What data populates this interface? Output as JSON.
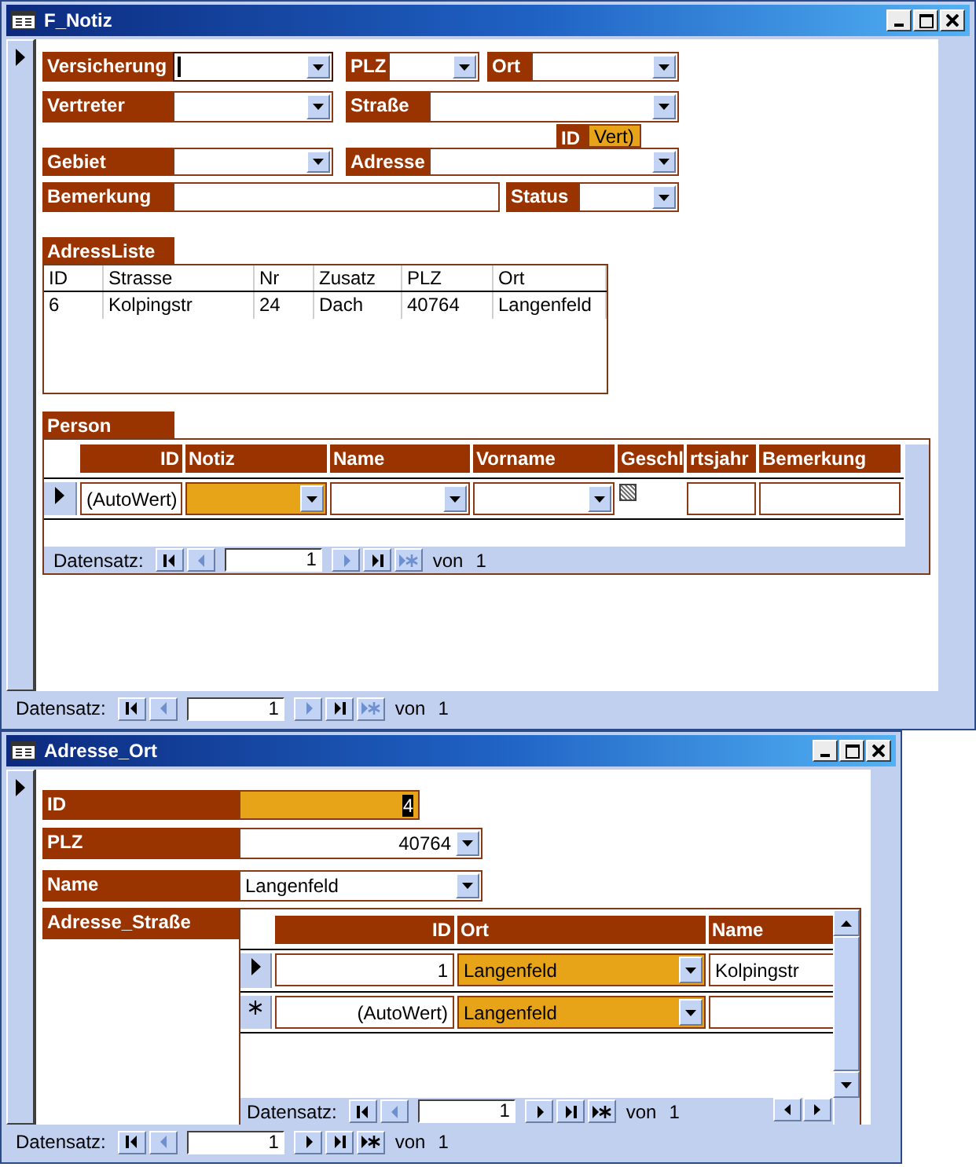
{
  "notiz_window": {
    "title": "F_Notiz",
    "record_selector": {
      "kind": "current"
    },
    "field_rows": [
      [
        {
          "label": "Versicherung",
          "kind": "combo",
          "focused": true
        },
        {
          "label": "PLZ",
          "kind": "combo",
          "focused": false
        },
        {
          "label": "Ort",
          "kind": "combo",
          "focused": false
        }
      ],
      [
        {
          "label": "Vertreter",
          "kind": "combo",
          "focused": false
        },
        {
          "label": "Straße",
          "kind": "combo",
          "focused": false
        }
      ],
      [
        {
          "label": "Gebiet",
          "kind": "combo",
          "focused": false
        },
        {
          "label": "Adresse",
          "kind": "combo",
          "focused": false
        }
      ],
      [
        {
          "label": "Bemerkung",
          "kind": "text",
          "focused": false
        },
        {
          "label": "Status",
          "kind": "combo",
          "focused": false
        }
      ]
    ],
    "id_vert": {
      "label": "ID",
      "value": "Vert)",
      "highlighted": true
    },
    "adress_liste": {
      "title": "AdressListe",
      "columns": [
        "ID",
        "Strasse",
        "Nr",
        "Zusatz",
        "PLZ",
        "Ort"
      ],
      "rows": [
        [
          "6",
          "Kolpingstr",
          "24",
          "Dach",
          "40764",
          "Langenfeld"
        ]
      ]
    },
    "person": {
      "title": "Person",
      "columns": [
        {
          "label": "ID",
          "kind": "number"
        },
        {
          "label": "Notiz",
          "kind": "combo"
        },
        {
          "label": "Name",
          "kind": "combo"
        },
        {
          "label": "Vorname",
          "kind": "combo"
        },
        {
          "label": "Geschl",
          "kind": "checkbox"
        },
        {
          "label": "rtsjahr",
          "kind": "text"
        },
        {
          "label": "Bemerkung",
          "kind": "text"
        }
      ],
      "rows": [
        {
          "kind": "current",
          "cells": [
            {
              "value": "(AutoWert)",
              "highlighted": false
            },
            {
              "highlighted": true
            },
            {
              "highlighted": false
            },
            {
              "highlighted": false
            },
            {
              "indeterminate": true
            },
            {
              "highlighted": false
            },
            {
              "highlighted": false
            }
          ]
        }
      ],
      "navigator": {
        "label": "Datensatz:",
        "value": "1",
        "buttons": [
          {
            "kind": "first",
            "disabled": false
          },
          {
            "kind": "previous",
            "disabled": true
          },
          {
            "kind": "next",
            "disabled": true
          },
          {
            "kind": "last",
            "disabled": false
          },
          {
            "kind": "new",
            "disabled": true
          }
        ],
        "of_label": "von",
        "total": "1"
      }
    },
    "navigator": {
      "label": "Datensatz:",
      "value": "1",
      "buttons": [
        {
          "kind": "first",
          "disabled": false
        },
        {
          "kind": "previous",
          "disabled": true
        },
        {
          "kind": "next",
          "disabled": true
        },
        {
          "kind": "last",
          "disabled": false
        },
        {
          "kind": "new",
          "disabled": true
        }
      ],
      "of_label": "von",
      "total": "1"
    }
  },
  "adresse_window": {
    "title": "Adresse_Ort",
    "record_selector": {
      "kind": "current"
    },
    "fields": [
      {
        "label": "ID",
        "kind": "number",
        "value": "4",
        "highlighted": true,
        "text_selected": true
      },
      {
        "label": "PLZ",
        "kind": "number_combo",
        "value": "40764",
        "highlighted": false,
        "text_selected": false
      },
      {
        "label": "Name",
        "kind": "combo",
        "value": "Langenfeld",
        "highlighted": false,
        "text_selected": false
      }
    ],
    "subform": {
      "title": "Adresse_Straße",
      "columns": [
        {
          "label": "ID",
          "kind": "number"
        },
        {
          "label": "Ort",
          "kind": "combo"
        },
        {
          "label": "Name",
          "kind": "text"
        }
      ],
      "rows": [
        {
          "kind": "current",
          "cells": [
            {
              "value": "1",
              "highlighted": false
            },
            {
              "value": "Langenfeld",
              "highlighted": true
            },
            {
              "value": "Kolpingstr",
              "highlighted": false
            }
          ]
        },
        {
          "kind": "new",
          "cells": [
            {
              "value": "(AutoWert)",
              "highlighted": false
            },
            {
              "value": "Langenfeld",
              "highlighted": true
            },
            {
              "highlighted": false
            }
          ]
        }
      ],
      "navigator": {
        "label": "Datensatz:",
        "value": "1",
        "buttons": [
          {
            "kind": "first",
            "disabled": false
          },
          {
            "kind": "previous",
            "disabled": true
          },
          {
            "kind": "next",
            "disabled": false
          },
          {
            "kind": "last",
            "disabled": false
          },
          {
            "kind": "new",
            "disabled": false
          }
        ],
        "of_label": "von",
        "total": "1"
      }
    },
    "navigator": {
      "label": "Datensatz:",
      "value": "1",
      "buttons": [
        {
          "kind": "first",
          "disabled": false
        },
        {
          "kind": "previous",
          "disabled": true
        },
        {
          "kind": "next",
          "disabled": false
        },
        {
          "kind": "last",
          "disabled": false
        },
        {
          "kind": "new",
          "disabled": false
        }
      ],
      "of_label": "von",
      "total": "1"
    }
  }
}
